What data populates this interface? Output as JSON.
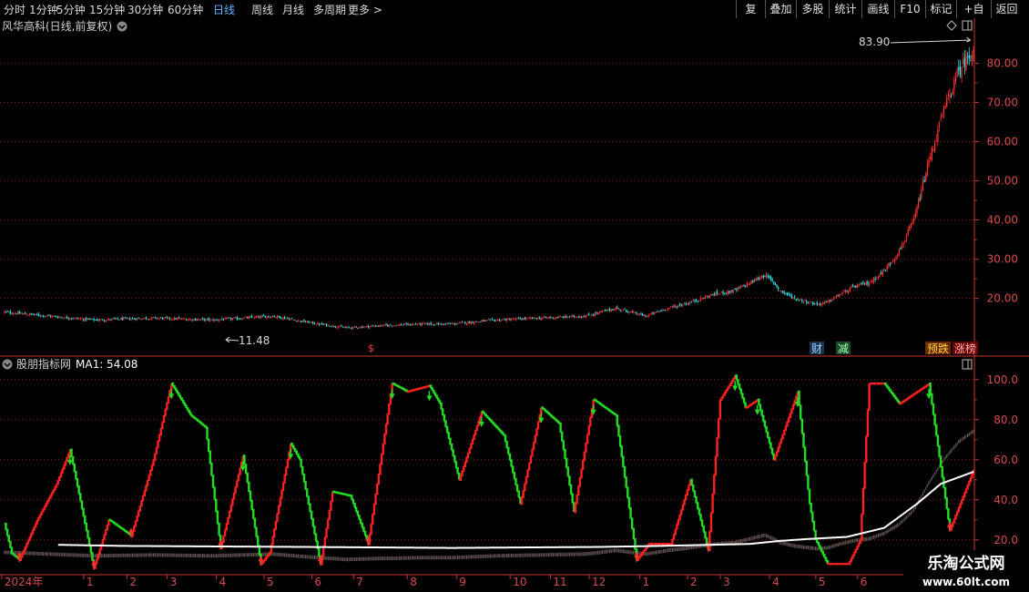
{
  "toolbar": {
    "periods": [
      "分时",
      "1分钟",
      "5分钟",
      "15分钟",
      "30分钟",
      "60分钟",
      "日线",
      "周线",
      "月线",
      "多周期",
      "更多 >"
    ],
    "active_index": 6,
    "right_buttons": [
      "复权",
      "叠加",
      "多股",
      "统计",
      "画线",
      "F10",
      "标记",
      "+自选",
      "返回"
    ]
  },
  "main_panel": {
    "title": "风华高科(日线,前复权)",
    "high_label": "83.90",
    "low_label": "11.48",
    "markers": {
      "event_s": "$",
      "cai": "财",
      "jian": "减",
      "yudie": "预跌",
      "zhangbang": "涨榜"
    }
  },
  "sub_panel": {
    "title": "股朋指标网",
    "ma_label": "MA1: 54.08"
  },
  "watermark": {
    "line1": "乐淘公式网",
    "line2": "www.60lt.com"
  },
  "colors": {
    "up": "#ff3232",
    "down": "#2ee8e8",
    "osc_up": "#ff2020",
    "osc_down": "#22dd22",
    "ma": "#ffffff",
    "grid": "#7a1a1a",
    "axis": "#cc3333"
  },
  "chart_data": [
    {
      "type": "candlestick",
      "title": "风华高科(日线,前复权)",
      "y_ticks": [
        20,
        30,
        40,
        50,
        60,
        70,
        80
      ],
      "ylim": [
        9,
        88
      ],
      "close_keypoints": {
        "x": [
          0,
          30,
          60,
          100,
          140,
          180,
          210,
          230,
          250,
          280,
          300,
          330,
          360,
          390,
          410,
          430,
          445,
          460,
          475,
          490,
          500,
          510,
          516,
          520,
          530,
          540,
          545,
          552,
          560,
          570,
          580,
          590,
          600,
          610,
          620,
          630,
          640,
          650
        ],
        "y": [
          16.5,
          15.5,
          14.5,
          15,
          14.5,
          15.5,
          13.5,
          12.5,
          13,
          13.5,
          13.5,
          14.5,
          15,
          15.5,
          17.5,
          15.5,
          17.5,
          19,
          21,
          22,
          24,
          26,
          24,
          22,
          20,
          19,
          18.5,
          19,
          21,
          23,
          24,
          27,
          32,
          40,
          55,
          68,
          78,
          83.9
        ]
      },
      "high": 83.9,
      "low": 11.48
    },
    {
      "type": "line",
      "title": "股朋指标网",
      "y_ticks": [
        20,
        40,
        60,
        80,
        100
      ],
      "ylim": [
        4,
        104
      ],
      "series": [
        {
          "name": "MA1",
          "last_value": 54.08
        }
      ],
      "oscillator_keypoints": {
        "x": [
          0,
          5,
          10,
          22,
          35,
          44,
          60,
          70,
          85,
          100,
          112,
          125,
          135,
          145,
          160,
          172,
          178,
          192,
          198,
          212,
          220,
          232,
          244,
          260,
          270,
          285,
          292,
          305,
          320,
          335,
          346,
          360,
          372,
          382,
          395,
          410,
          424,
          432,
          447,
          460,
          472,
          480,
          490,
          497,
          505,
          516,
          532,
          540,
          544,
          552,
          566,
          574,
          580,
          590,
          600,
          620,
          634,
          650
        ],
        "y": [
          28,
          13,
          10,
          30,
          48,
          65,
          6,
          30,
          22,
          60,
          98,
          82,
          76,
          16,
          62,
          8,
          14,
          68,
          60,
          8,
          44,
          42,
          18,
          98,
          94,
          97,
          88,
          50,
          84,
          72,
          38,
          86,
          78,
          34,
          90,
          82,
          10,
          18,
          18,
          50,
          15,
          90,
          102,
          86,
          90,
          60,
          94,
          38,
          20,
          8,
          8,
          20,
          98,
          98,
          88,
          98,
          25,
          55
        ]
      },
      "ma_keypoints": {
        "x": [
          0,
          80,
          200,
          300,
          400,
          440,
          500,
          520,
          540,
          565,
          590,
          612,
          628,
          650
        ],
        "y": [
          18,
          17,
          16.5,
          16,
          16.5,
          17,
          18,
          19.5,
          20.5,
          21.5,
          26,
          38,
          48,
          54
        ]
      }
    }
  ],
  "xaxis": {
    "labels": [
      "2024年",
      "1",
      "2",
      "3",
      "4",
      "5",
      "6",
      "7",
      "8",
      "9",
      "10",
      "11",
      "12",
      "1",
      "2",
      "3",
      "4",
      "5",
      "6"
    ],
    "label_bars": [
      0,
      55,
      84,
      111,
      144,
      176,
      208,
      236,
      272,
      305,
      341,
      368,
      394,
      428,
      460,
      482,
      515,
      546,
      574
    ]
  }
}
